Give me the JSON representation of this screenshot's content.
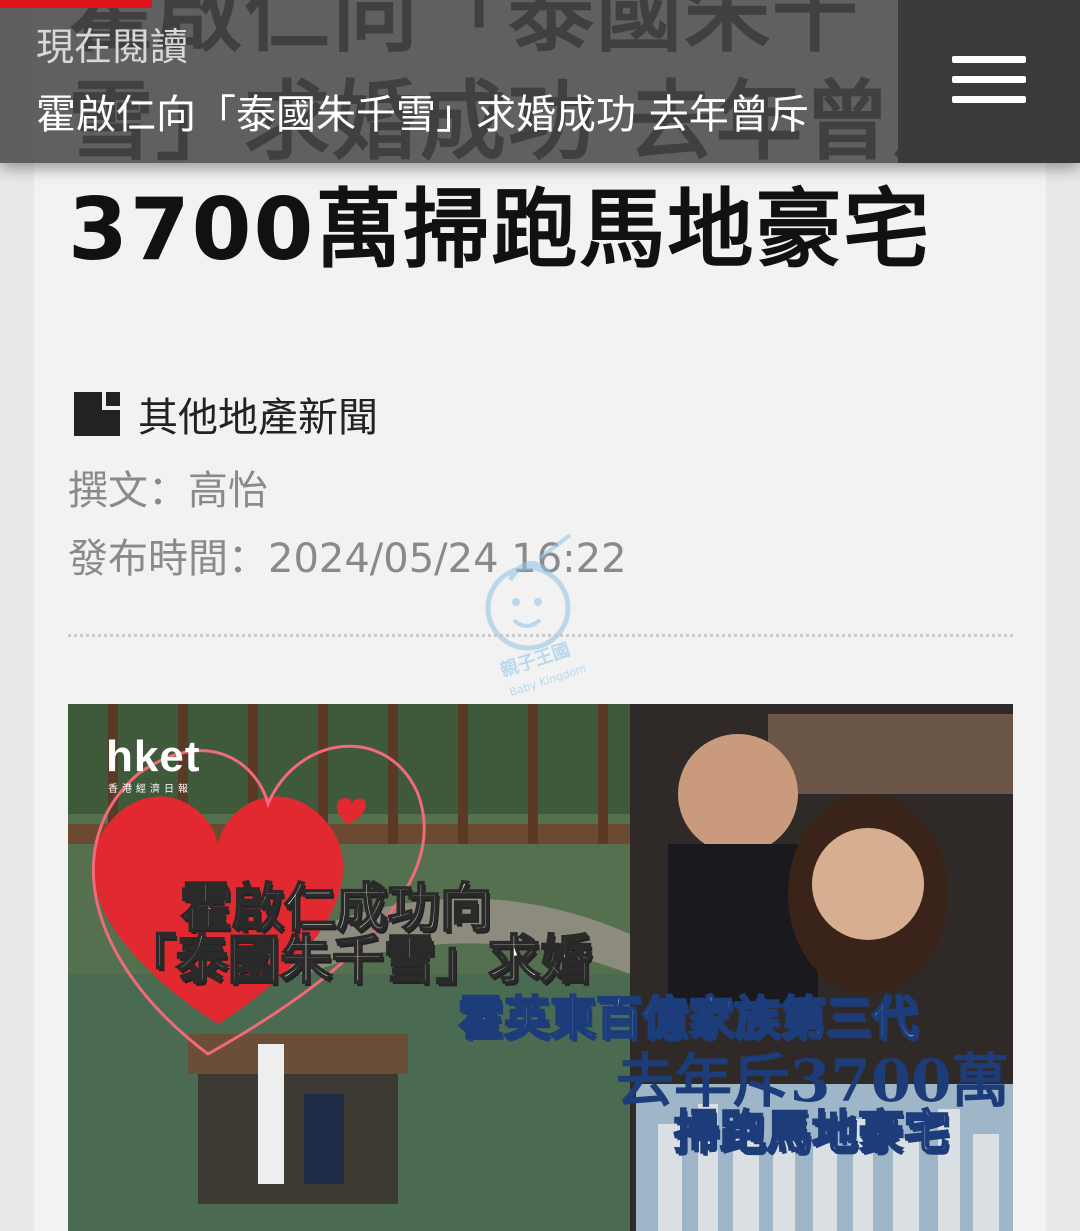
{
  "header": {
    "now_reading_label": "現在閱讀",
    "current_title": "霍啟仁向「泰國朱千雪」求婚成功 去年曾斥"
  },
  "article": {
    "title": "霍啟仁向「泰國朱千雪」求婚成功 去年曾斥3700萬掃跑馬地豪宅",
    "section": "其他地產新聞",
    "byline": "撰文：高怡",
    "published": "發布時間：2024/05/24 16:22"
  },
  "hero_image": {
    "logo": "hket",
    "logo_sub": "香港經濟日報",
    "lines": [
      "霍啟仁成功向",
      "「泰國朱千雪」求婚",
      "霍英東百億家族第三代",
      "去年斥3700萬",
      "掃跑馬地豪宅"
    ]
  },
  "watermark": {
    "label": "親子王國",
    "sub": "Baby Kingdom"
  },
  "colors": {
    "accent_red": "#e1131b",
    "header_bg": "#484848",
    "card_bg": "#f2f2f2"
  },
  "icons": {
    "menu": "hamburger-menu-icon",
    "section": "document-icon"
  }
}
